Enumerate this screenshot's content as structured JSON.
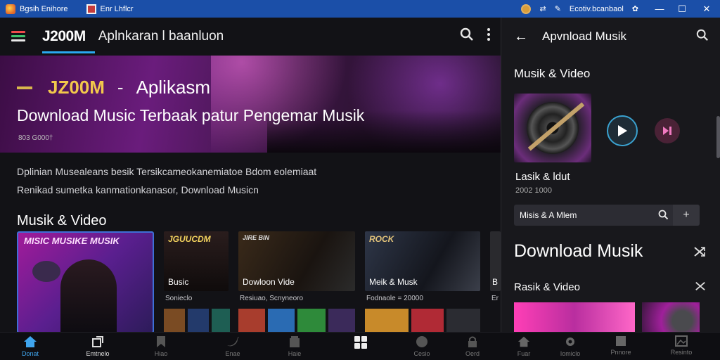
{
  "titlebar": {
    "left_title": "Bgsih Enihore",
    "doc_title": "Enr Lhflcr",
    "right_text": "Ecotiv.bcanbaol",
    "minimize": "—",
    "maximize": "☐",
    "close": "✕"
  },
  "appbar": {
    "brand": "J200M",
    "subtitle": "Aplnkaran l baanluon"
  },
  "hero": {
    "brand": "JZ00M",
    "separator": "-",
    "title_suffix": "Aplikasm",
    "headline": "Download Music Terbaak patur Pengemar Musik",
    "meta": "803 G000†"
  },
  "description": {
    "line1": "Dplinian Musealeans besik Tersikcameokanemiatoe Bdom eolemiaat",
    "line2": "Renikad sumetka kanmationkanasor, Download Musicn"
  },
  "section": {
    "title": "Musik & Video"
  },
  "cards": [
    {
      "caption": "MISIC MUSIKE MUSIK"
    },
    {
      "label": "Busic",
      "overlay": "JGUUCDM",
      "caption": "Sonieclo"
    },
    {
      "label": "Dowloon Vide",
      "overlay": "JIRE BIN",
      "caption": "Resiuao, Scnyneoro"
    },
    {
      "label": "Meik & Musk",
      "overlay": "ROCK",
      "caption": "Fodnaole = 20000"
    },
    {
      "label": "B",
      "caption": "Er"
    }
  ],
  "side": {
    "title": "Apvnload Musik",
    "section": "Musik & Video",
    "track_title": "Lasik & ldut",
    "track_meta": "2002 1000",
    "search_value": "Misis & A Mlem",
    "download_heading": "Download Musik",
    "section2": "Rasik & Video"
  },
  "bottomnav": [
    {
      "label": "Donat",
      "icon": "home-icon",
      "active": true
    },
    {
      "label": "Emtnelo",
      "icon": "share-icon",
      "active": false
    },
    {
      "label": "Hiao",
      "icon": "bookmark-icon",
      "active": false
    },
    {
      "label": "Enae",
      "icon": "twitter-icon",
      "active": false
    },
    {
      "label": "Haie",
      "icon": "archive-icon",
      "active": false
    },
    {
      "label": "",
      "icon": "grid-icon",
      "active": false
    },
    {
      "label": "Cesio",
      "icon": "account-icon",
      "active": false
    },
    {
      "label": "Oerd",
      "icon": "lock-icon",
      "active": false
    },
    {
      "label": "Fuar",
      "icon": "home-icon",
      "active": false
    },
    {
      "label": "Iomiclo",
      "icon": "gear-icon",
      "active": false
    },
    {
      "label": "Pnnore",
      "icon": "bookmark-icon",
      "active": false
    },
    {
      "label": "Resinto",
      "icon": "image-icon",
      "active": false
    }
  ],
  "colors": {
    "accent": "#2aa8f0",
    "titlebar": "#1b4fa8",
    "brand_gold": "#f2c84b"
  }
}
